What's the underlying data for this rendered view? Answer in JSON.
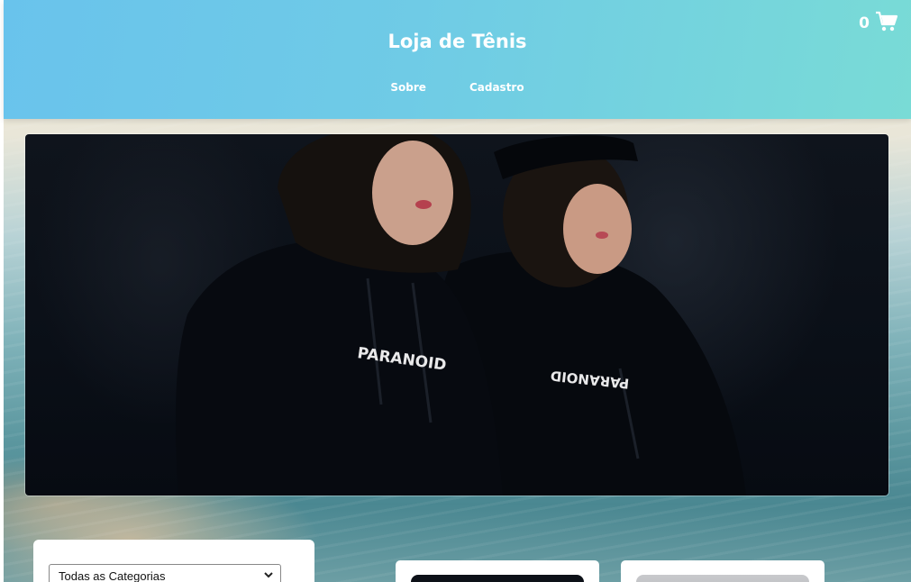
{
  "header": {
    "title": "Loja de Tênis",
    "nav": [
      {
        "label": "Sobre"
      },
      {
        "label": "Cadastro"
      }
    ],
    "cart": {
      "count": "0",
      "icon": "shopping-cart-icon"
    }
  },
  "hero": {
    "image": "two-people-black-hoodies",
    "print_left": "PARANOID",
    "print_right": "PARANOID"
  },
  "filters": {
    "category_selected": "Todas as Categorias"
  },
  "products": [
    {
      "thumb": "dark-product-image"
    },
    {
      "thumb": "light-product-image"
    }
  ],
  "colors": {
    "header_start": "#69c3ec",
    "header_end": "#79dbd6",
    "text_on_header": "#ffffff"
  }
}
